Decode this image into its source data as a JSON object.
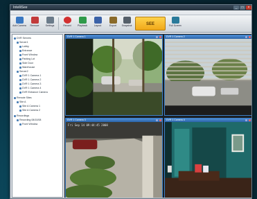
{
  "window": {
    "title": "IntelliSee",
    "controls": [
      "_",
      "□",
      "×"
    ]
  },
  "menu": [
    "File",
    "View",
    "Tools",
    "Layouts",
    "Recordings",
    "Windows",
    "Help",
    "Options",
    "Help"
  ],
  "toolbar": {
    "buttons": [
      {
        "label": "Add Camera",
        "icon": "add-camera-icon",
        "color": "#3a78c2"
      },
      {
        "label": "Remove",
        "icon": "remove-icon",
        "color": "#c23a3a"
      },
      {
        "label": "Settings",
        "icon": "gear-icon",
        "color": "#6b7b8a"
      },
      {
        "label": "Record",
        "icon": "record-icon",
        "color": "#d23030"
      },
      {
        "label": "Playback",
        "icon": "playback-icon",
        "color": "#2f9a4a"
      },
      {
        "label": "Layout",
        "icon": "layout-icon",
        "color": "#3b62a8"
      },
      {
        "label": "Export",
        "icon": "export-icon",
        "color": "#8a6a2a"
      },
      {
        "label": "Snapshot",
        "icon": "camera-icon",
        "color": "#555f6a"
      },
      {
        "label": "Full Screen",
        "icon": "fullscreen-icon",
        "color": "#2a7a9a"
      }
    ],
    "logo_text": "SEE"
  },
  "tree": [
    {
      "label": "DVR Servers",
      "indent": 0
    },
    {
      "label": "Server1",
      "indent": 1
    },
    {
      "label": "Lobby",
      "indent": 2
    },
    {
      "label": "Entrance",
      "indent": 2
    },
    {
      "label": "Front Window",
      "indent": 2
    },
    {
      "label": "Parking Lot",
      "indent": 2
    },
    {
      "label": "Side Door",
      "indent": 2
    },
    {
      "label": "Warehouse",
      "indent": 2
    },
    {
      "label": "Server2",
      "indent": 1
    },
    {
      "label": "DVR 1 Camera 1",
      "indent": 2
    },
    {
      "label": "DVR 1 Camera 2",
      "indent": 2
    },
    {
      "label": "DVR 1 Camera 3",
      "indent": 2
    },
    {
      "label": "DVR 1 Camera 4",
      "indent": 2
    },
    {
      "label": "DVR Entrance Camera",
      "indent": 2
    },
    {
      "label": "Remote Sites",
      "indent": 0
    },
    {
      "label": "Site A",
      "indent": 1
    },
    {
      "label": "Site A Camera 1",
      "indent": 2
    },
    {
      "label": "Site A Camera 2",
      "indent": 2
    },
    {
      "label": "Recordings",
      "indent": 0
    },
    {
      "label": "Recording 08/10/08",
      "indent": 1
    },
    {
      "label": "Front Window",
      "indent": 2
    }
  ],
  "cameras": [
    {
      "title": "DVR 1 Camera 1",
      "timestamp": ""
    },
    {
      "title": "DVR 1 Camera 2",
      "timestamp": ""
    },
    {
      "title": "DVR 1 Camera 3",
      "timestamp": "Fri Sep 14   09:44:45   2008"
    },
    {
      "title": "DVR 1 Camera 4",
      "timestamp": ""
    }
  ],
  "colors": {
    "accent": "#3c80c8",
    "background": "#082c3a"
  }
}
